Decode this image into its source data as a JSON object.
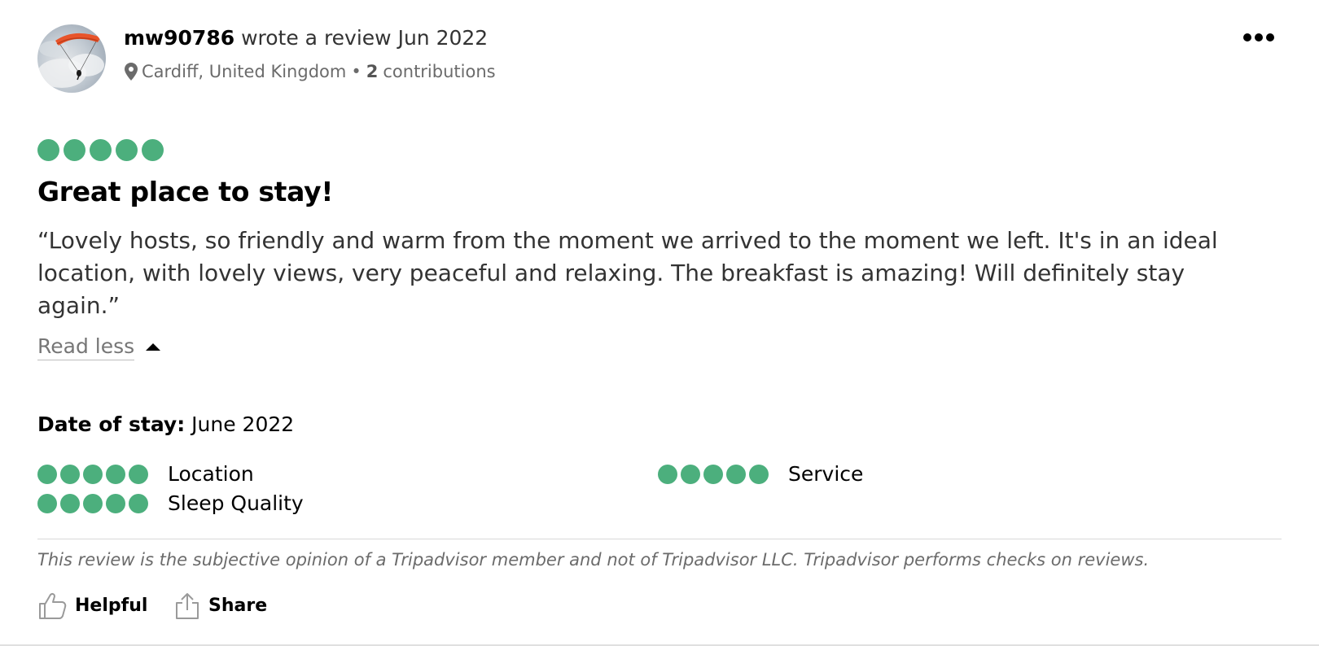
{
  "reviewer": {
    "name": "mw90786",
    "action": "wrote a review Jun 2022",
    "location": "Cardiff, United Kingdom",
    "separator": "•",
    "contributions_count": "2",
    "contributions_label": "contributions"
  },
  "review": {
    "rating": 5,
    "rating_max": 5,
    "title": "Great place to stay!",
    "body": "“Lovely hosts, so friendly and warm from the moment we arrived to the moment we left. It's in an ideal location, with lovely views, very peaceful and relaxing. The breakfast is amazing! Will definitely stay again.”",
    "read_less": "Read less",
    "date_of_stay_label": "Date of stay:",
    "date_of_stay_value": "June 2022"
  },
  "subratings": [
    {
      "label": "Location",
      "rating": 5
    },
    {
      "label": "Service",
      "rating": 5
    },
    {
      "label": "Sleep Quality",
      "rating": 5
    }
  ],
  "disclaimer": "This review is the subjective opinion of a Tripadvisor member and not of Tripadvisor LLC. Tripadvisor performs checks on reviews.",
  "actions": {
    "helpful_label": "Helpful",
    "share_label": "Share"
  },
  "icons": {
    "more": "more-dots-icon",
    "location": "map-pin-icon",
    "helpful": "thumbs-up-icon",
    "share": "share-icon",
    "read_less": "caret-up-icon"
  },
  "colors": {
    "bubble_filled": "#4caf7d",
    "bubble_empty": "#ffffff",
    "text_primary": "#000000",
    "text_secondary": "#6b6b6b"
  }
}
